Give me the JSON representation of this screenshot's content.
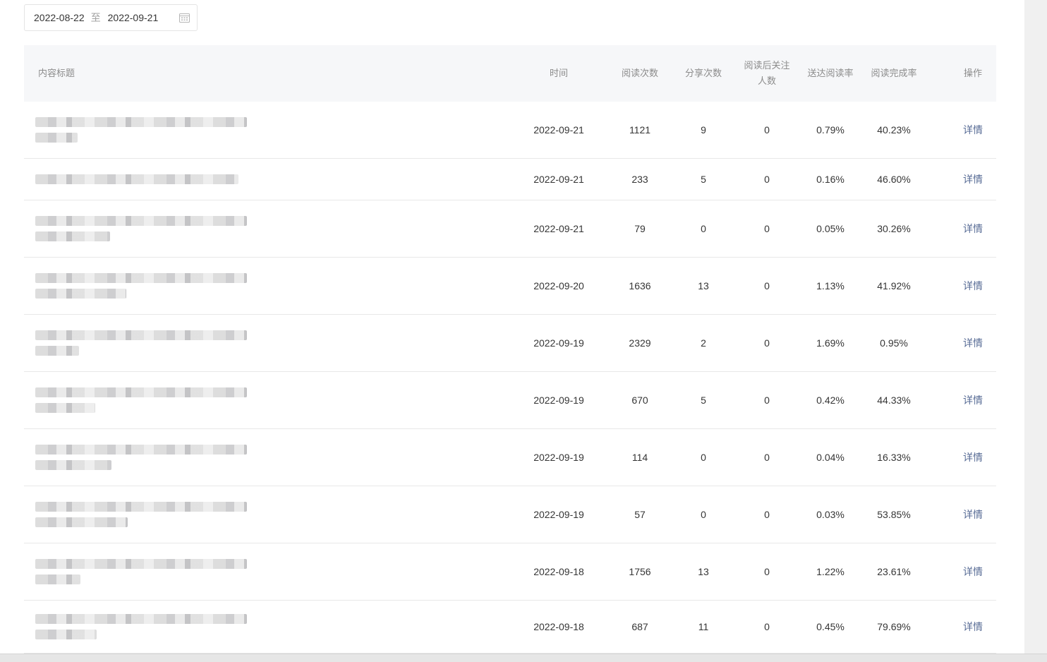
{
  "date_range": {
    "start": "2022-08-22",
    "separator": "至",
    "end": "2022-09-21",
    "icon": "calendar-icon"
  },
  "table": {
    "headers": {
      "title": "内容标题",
      "time": "时间",
      "reads": "阅读次数",
      "shares": "分享次数",
      "follows_line1": "阅读后关注",
      "follows_line2": "人数",
      "delivery_rate": "送达阅读率",
      "completion_rate": "阅读完成率",
      "action": "操作"
    },
    "rows": [
      {
        "date": "2022-09-21",
        "reads": "1121",
        "shares": "9",
        "follows": "0",
        "delivery_rate": "0.79%",
        "completion_rate": "40.23%",
        "action": "详情"
      },
      {
        "date": "2022-09-21",
        "reads": "233",
        "shares": "5",
        "follows": "0",
        "delivery_rate": "0.16%",
        "completion_rate": "46.60%",
        "action": "详情"
      },
      {
        "date": "2022-09-21",
        "reads": "79",
        "shares": "0",
        "follows": "0",
        "delivery_rate": "0.05%",
        "completion_rate": "30.26%",
        "action": "详情"
      },
      {
        "date": "2022-09-20",
        "reads": "1636",
        "shares": "13",
        "follows": "0",
        "delivery_rate": "1.13%",
        "completion_rate": "41.92%",
        "action": "详情"
      },
      {
        "date": "2022-09-19",
        "reads": "2329",
        "shares": "2",
        "follows": "0",
        "delivery_rate": "1.69%",
        "completion_rate": "0.95%",
        "action": "详情"
      },
      {
        "date": "2022-09-19",
        "reads": "670",
        "shares": "5",
        "follows": "0",
        "delivery_rate": "0.42%",
        "completion_rate": "44.33%",
        "action": "详情"
      },
      {
        "date": "2022-09-19",
        "reads": "114",
        "shares": "0",
        "follows": "0",
        "delivery_rate": "0.04%",
        "completion_rate": "16.33%",
        "action": "详情"
      },
      {
        "date": "2022-09-19",
        "reads": "57",
        "shares": "0",
        "follows": "0",
        "delivery_rate": "0.03%",
        "completion_rate": "53.85%",
        "action": "详情"
      },
      {
        "date": "2022-09-18",
        "reads": "1756",
        "shares": "13",
        "follows": "0",
        "delivery_rate": "1.22%",
        "completion_rate": "23.61%",
        "action": "详情"
      },
      {
        "date": "2022-09-18",
        "reads": "687",
        "shares": "11",
        "follows": "0",
        "delivery_rate": "0.45%",
        "completion_rate": "79.69%",
        "action": "详情"
      }
    ]
  }
}
